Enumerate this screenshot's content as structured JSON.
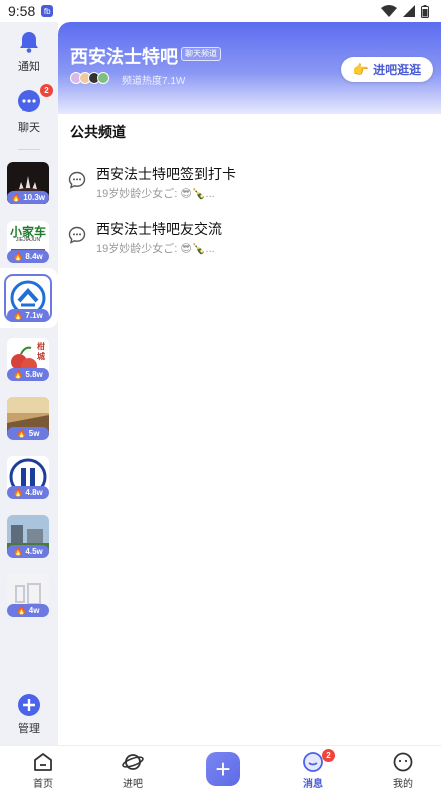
{
  "status": {
    "time": "9:58",
    "app_badge": "fb"
  },
  "sidebar": {
    "notify_label": "通知",
    "chat_label": "聊天",
    "chat_badge": "2",
    "manage_label": "管理",
    "bars": [
      {
        "heat": "10.3w"
      },
      {
        "heat": "8.4w",
        "logo_text": "小家车",
        "logo_sub": "JIEJIAJUN"
      },
      {
        "heat": "7.1w"
      },
      {
        "heat": "5.8w",
        "logo_text": "柑城"
      },
      {
        "heat": "5w"
      },
      {
        "heat": "4.8w"
      },
      {
        "heat": "4.5w"
      },
      {
        "heat": "4w"
      }
    ]
  },
  "header": {
    "title": "西安法士特吧",
    "tag": "聊天频道",
    "heat_text": "频道热度7.1W",
    "visit_label": "进吧逛逛"
  },
  "section_title": "公共频道",
  "channels": [
    {
      "name": "西安法士特吧签到打卡",
      "last_msg": "19岁妙龄少女ご: 😎🍾..."
    },
    {
      "name": "西安法士特吧友交流",
      "last_msg": "19岁妙龄少女ご: 😎🍾..."
    }
  ],
  "bottom_nav": {
    "home": "首页",
    "bars": "进吧",
    "messages": "消息",
    "messages_badge": "2",
    "mine": "我的"
  }
}
